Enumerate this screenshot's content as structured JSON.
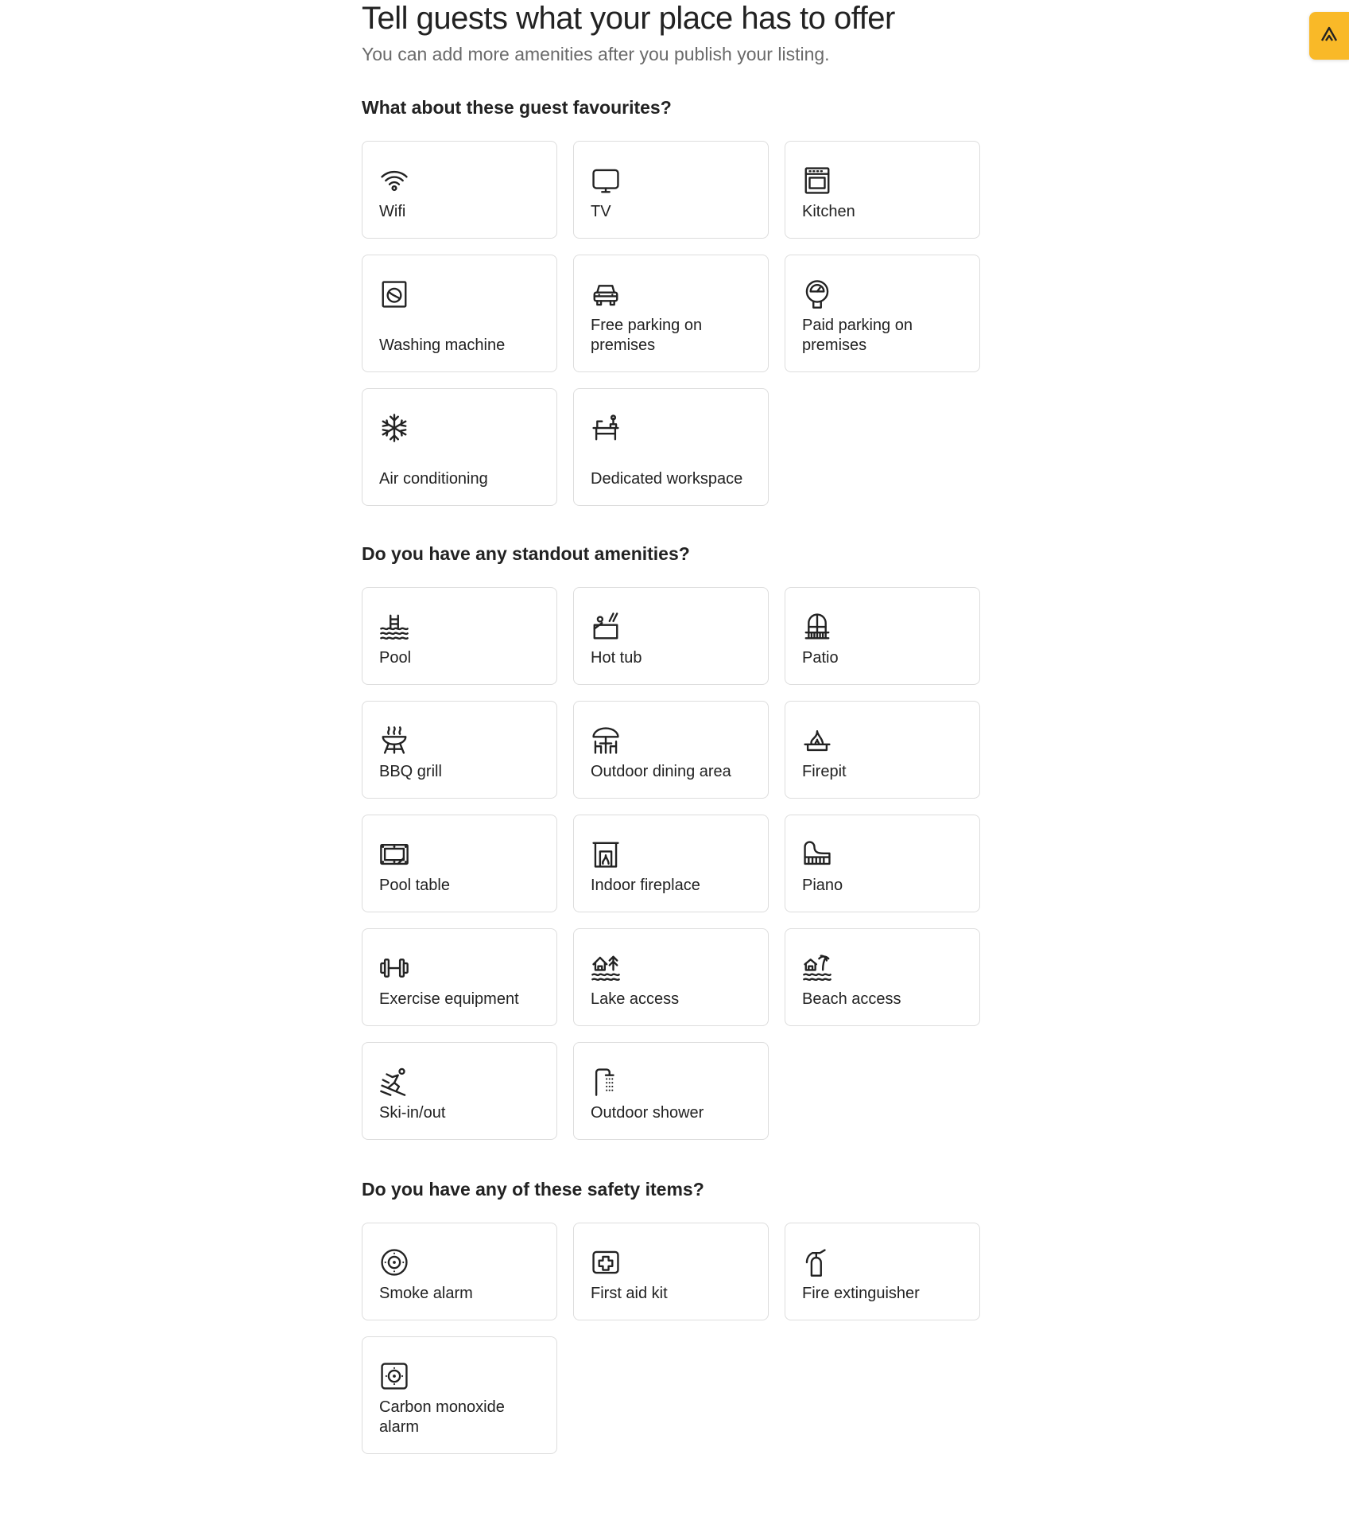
{
  "header": {
    "title": "Tell guests what your place has to offer",
    "subtitle": "You can add more amenities after you publish your listing."
  },
  "corner_button": {
    "icon": "extension-logo-icon",
    "color": "#f9b928"
  },
  "sections": {
    "favourites": {
      "title": "What about these guest favourites?",
      "items": [
        {
          "label": "Wifi",
          "icon": "wifi-icon"
        },
        {
          "label": "TV",
          "icon": "tv-icon"
        },
        {
          "label": "Kitchen",
          "icon": "kitchen-icon"
        },
        {
          "label": "Washing machine",
          "icon": "washing-machine-icon"
        },
        {
          "label": "Free parking on premises",
          "icon": "car-icon"
        },
        {
          "label": "Paid parking on premises",
          "icon": "parking-meter-icon"
        },
        {
          "label": "Air conditioning",
          "icon": "snowflake-icon"
        },
        {
          "label": "Dedicated workspace",
          "icon": "desk-icon"
        }
      ]
    },
    "standout": {
      "title": "Do you have any standout amenities?",
      "items": [
        {
          "label": "Pool",
          "icon": "pool-icon"
        },
        {
          "label": "Hot tub",
          "icon": "hot-tub-icon"
        },
        {
          "label": "Patio",
          "icon": "patio-icon"
        },
        {
          "label": "BBQ grill",
          "icon": "bbq-grill-icon"
        },
        {
          "label": "Outdoor dining area",
          "icon": "outdoor-dining-icon"
        },
        {
          "label": "Firepit",
          "icon": "firepit-icon"
        },
        {
          "label": "Pool table",
          "icon": "pool-table-icon"
        },
        {
          "label": "Indoor fireplace",
          "icon": "fireplace-icon"
        },
        {
          "label": "Piano",
          "icon": "piano-icon"
        },
        {
          "label": "Exercise equipment",
          "icon": "dumbbell-icon"
        },
        {
          "label": "Lake access",
          "icon": "lake-icon"
        },
        {
          "label": "Beach access",
          "icon": "beach-icon"
        },
        {
          "label": "Ski-in/out",
          "icon": "ski-icon"
        },
        {
          "label": "Outdoor shower",
          "icon": "shower-icon"
        }
      ]
    },
    "safety": {
      "title": "Do you have any of these safety items?",
      "items": [
        {
          "label": "Smoke alarm",
          "icon": "smoke-alarm-icon"
        },
        {
          "label": "First aid kit",
          "icon": "first-aid-icon"
        },
        {
          "label": "Fire extinguisher",
          "icon": "fire-extinguisher-icon"
        },
        {
          "label": "Carbon monoxide alarm",
          "icon": "co-alarm-icon"
        }
      ]
    }
  }
}
